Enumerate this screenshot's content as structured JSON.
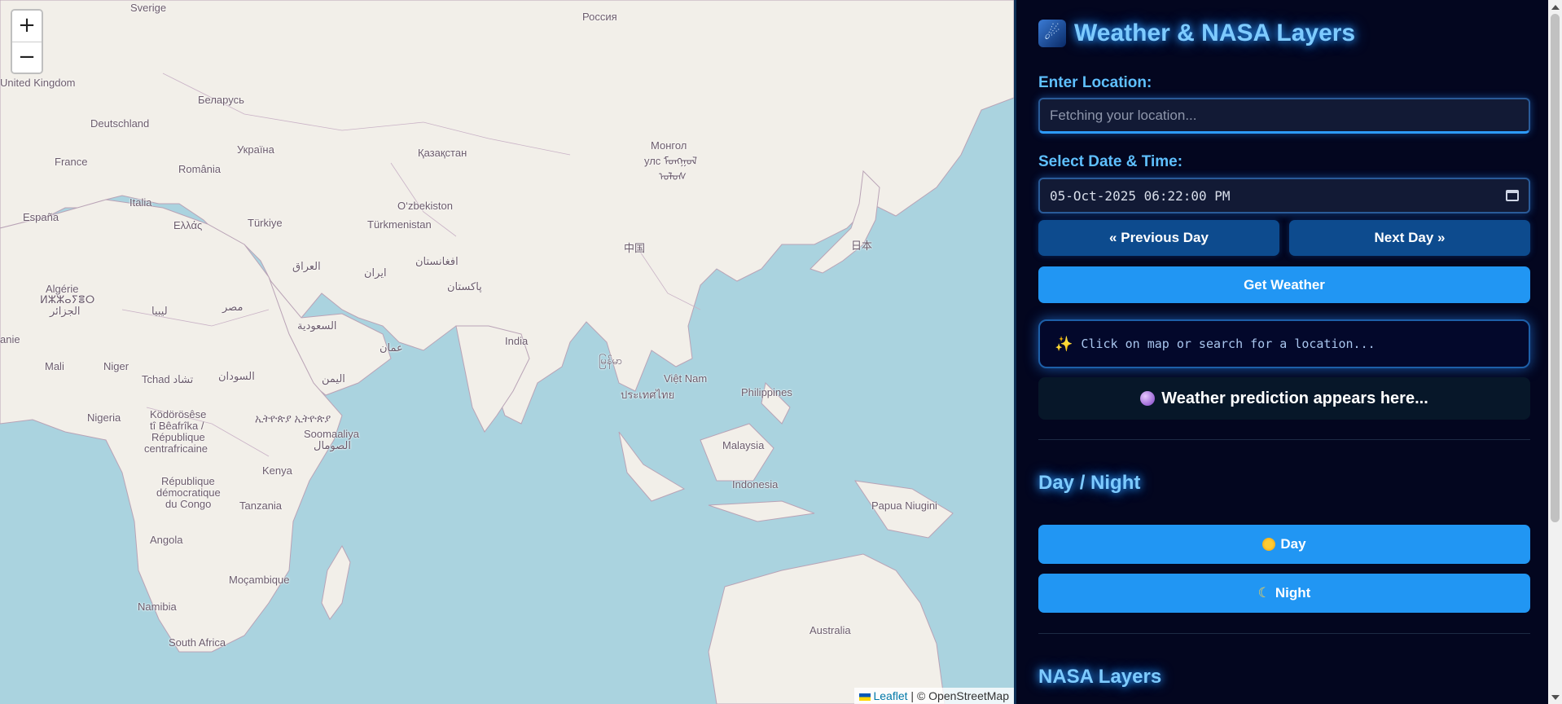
{
  "map": {
    "zoom_in": "+",
    "zoom_out": "−",
    "attribution": {
      "leaflet": "Leaflet",
      "separator": " | © ",
      "osm": "OpenStreetMap"
    },
    "labels": [
      {
        "id": "sverige",
        "text": "Sverige"
      },
      {
        "id": "rossiya",
        "text": "Россия"
      },
      {
        "id": "uk",
        "text": "United Kingdom"
      },
      {
        "id": "belarus",
        "text": "Беларусь"
      },
      {
        "id": "deutschland",
        "text": "Deutschland"
      },
      {
        "id": "ukraina",
        "text": "Україна"
      },
      {
        "id": "france",
        "text": "France"
      },
      {
        "id": "romania",
        "text": "România"
      },
      {
        "id": "kazakhstan",
        "text": "Қазақстан"
      },
      {
        "id": "mongol",
        "text": "Монгол"
      },
      {
        "id": "mongol2",
        "text": "улс ᠮᠣᠩᠭᠣᠯ"
      },
      {
        "id": "mongol3",
        "text": "ᠤᠯᠤᠰ"
      },
      {
        "id": "espana",
        "text": "España"
      },
      {
        "id": "italia",
        "text": "Italia"
      },
      {
        "id": "uzbekiston",
        "text": "O‘zbekiston"
      },
      {
        "id": "turkiye",
        "text": "Türkiye"
      },
      {
        "id": "ellas",
        "text": "Ελλάς"
      },
      {
        "id": "turkmenistan",
        "text": "Türkmenistan"
      },
      {
        "id": "japan",
        "text": "日本"
      },
      {
        "id": "china",
        "text": "中国"
      },
      {
        "id": "iraq",
        "text": "العراق"
      },
      {
        "id": "afghanistan",
        "text": "افغانستان"
      },
      {
        "id": "iran",
        "text": "ایران"
      },
      {
        "id": "algerie",
        "text": "Algérie"
      },
      {
        "id": "algerie2",
        "text": "ⵍⵣⵣⴰⵢⴻⵔ"
      },
      {
        "id": "algerie3",
        "text": "الجزائر"
      },
      {
        "id": "pakistan",
        "text": "پاکستان"
      },
      {
        "id": "libya",
        "text": "ليبيا"
      },
      {
        "id": "misr",
        "text": "مصر"
      },
      {
        "id": "saudi",
        "text": "السعودية"
      },
      {
        "id": "oman",
        "text": "عمان"
      },
      {
        "id": "india",
        "text": "India"
      },
      {
        "id": "myanmar",
        "text": "မြန်မာ"
      },
      {
        "id": "anie",
        "text": "anie"
      },
      {
        "id": "mali",
        "text": "Mali"
      },
      {
        "id": "niger",
        "text": "Niger"
      },
      {
        "id": "tchad",
        "text": "Tchad تشاد"
      },
      {
        "id": "sudan",
        "text": "السودان"
      },
      {
        "id": "yemen",
        "text": "اليمن"
      },
      {
        "id": "vietnam",
        "text": "Việt Nam"
      },
      {
        "id": "thailand",
        "text": "ประเทศไทย"
      },
      {
        "id": "philippines",
        "text": "Philippines"
      },
      {
        "id": "nigeria",
        "text": "Nigeria"
      },
      {
        "id": "kodorosese",
        "text": "Ködörösêse"
      },
      {
        "id": "kodorosese2",
        "text": "tî Bêafrîka /"
      },
      {
        "id": "kodorosese3",
        "text": "République"
      },
      {
        "id": "kodorosese4",
        "text": "centrafricaine"
      },
      {
        "id": "ethiopia",
        "text": "ኢትዮጵያ ኢትዮጵያ"
      },
      {
        "id": "somalia",
        "text": "Soomaaliya"
      },
      {
        "id": "somalia2",
        "text": "الصومال"
      },
      {
        "id": "malaysia",
        "text": "Malaysia"
      },
      {
        "id": "kenya",
        "text": "Kenya"
      },
      {
        "id": "rdc",
        "text": "République"
      },
      {
        "id": "rdc2",
        "text": "démocratique"
      },
      {
        "id": "rdc3",
        "text": "du Congo"
      },
      {
        "id": "indonesia",
        "text": "Indonesia"
      },
      {
        "id": "tanzania",
        "text": "Tanzania"
      },
      {
        "id": "png",
        "text": "Papua Niugini"
      },
      {
        "id": "angola",
        "text": "Angola"
      },
      {
        "id": "mocambique",
        "text": "Moçambique"
      },
      {
        "id": "namibia",
        "text": "Namibia"
      },
      {
        "id": "australia",
        "text": "Australia"
      },
      {
        "id": "southafrica",
        "text": "South Africa"
      }
    ]
  },
  "sidebar": {
    "title": "Weather & NASA Layers",
    "location_label": "Enter Location:",
    "location_placeholder": "Fetching your location...",
    "datetime_label": "Select Date & Time:",
    "datetime_value": "05-Oct-2025 06:22:00 PM",
    "prev_day": "« Previous Day",
    "next_day": "Next Day »",
    "get_weather": "Get Weather",
    "hint": "Click on map or search for a location...",
    "prediction": "Weather prediction appears here...",
    "day_night_title": "Day / Night",
    "day_button": "Day",
    "night_button": "Night",
    "nasa_layers_title": "NASA Layers"
  },
  "colors": {
    "map_water": "#aad3df",
    "map_land": "#f2efe9",
    "sidebar_bg": "#03061f",
    "accent_blue": "#2196f3",
    "nav_button": "#0d4b8e",
    "title_glow": "#7ecbff"
  },
  "icons": {
    "title": "rocket-icon",
    "hint": "sparkle-icon",
    "prediction": "crystal-ball-icon",
    "day": "sun-icon",
    "night": "moon-icon",
    "datetime": "calendar-icon"
  }
}
